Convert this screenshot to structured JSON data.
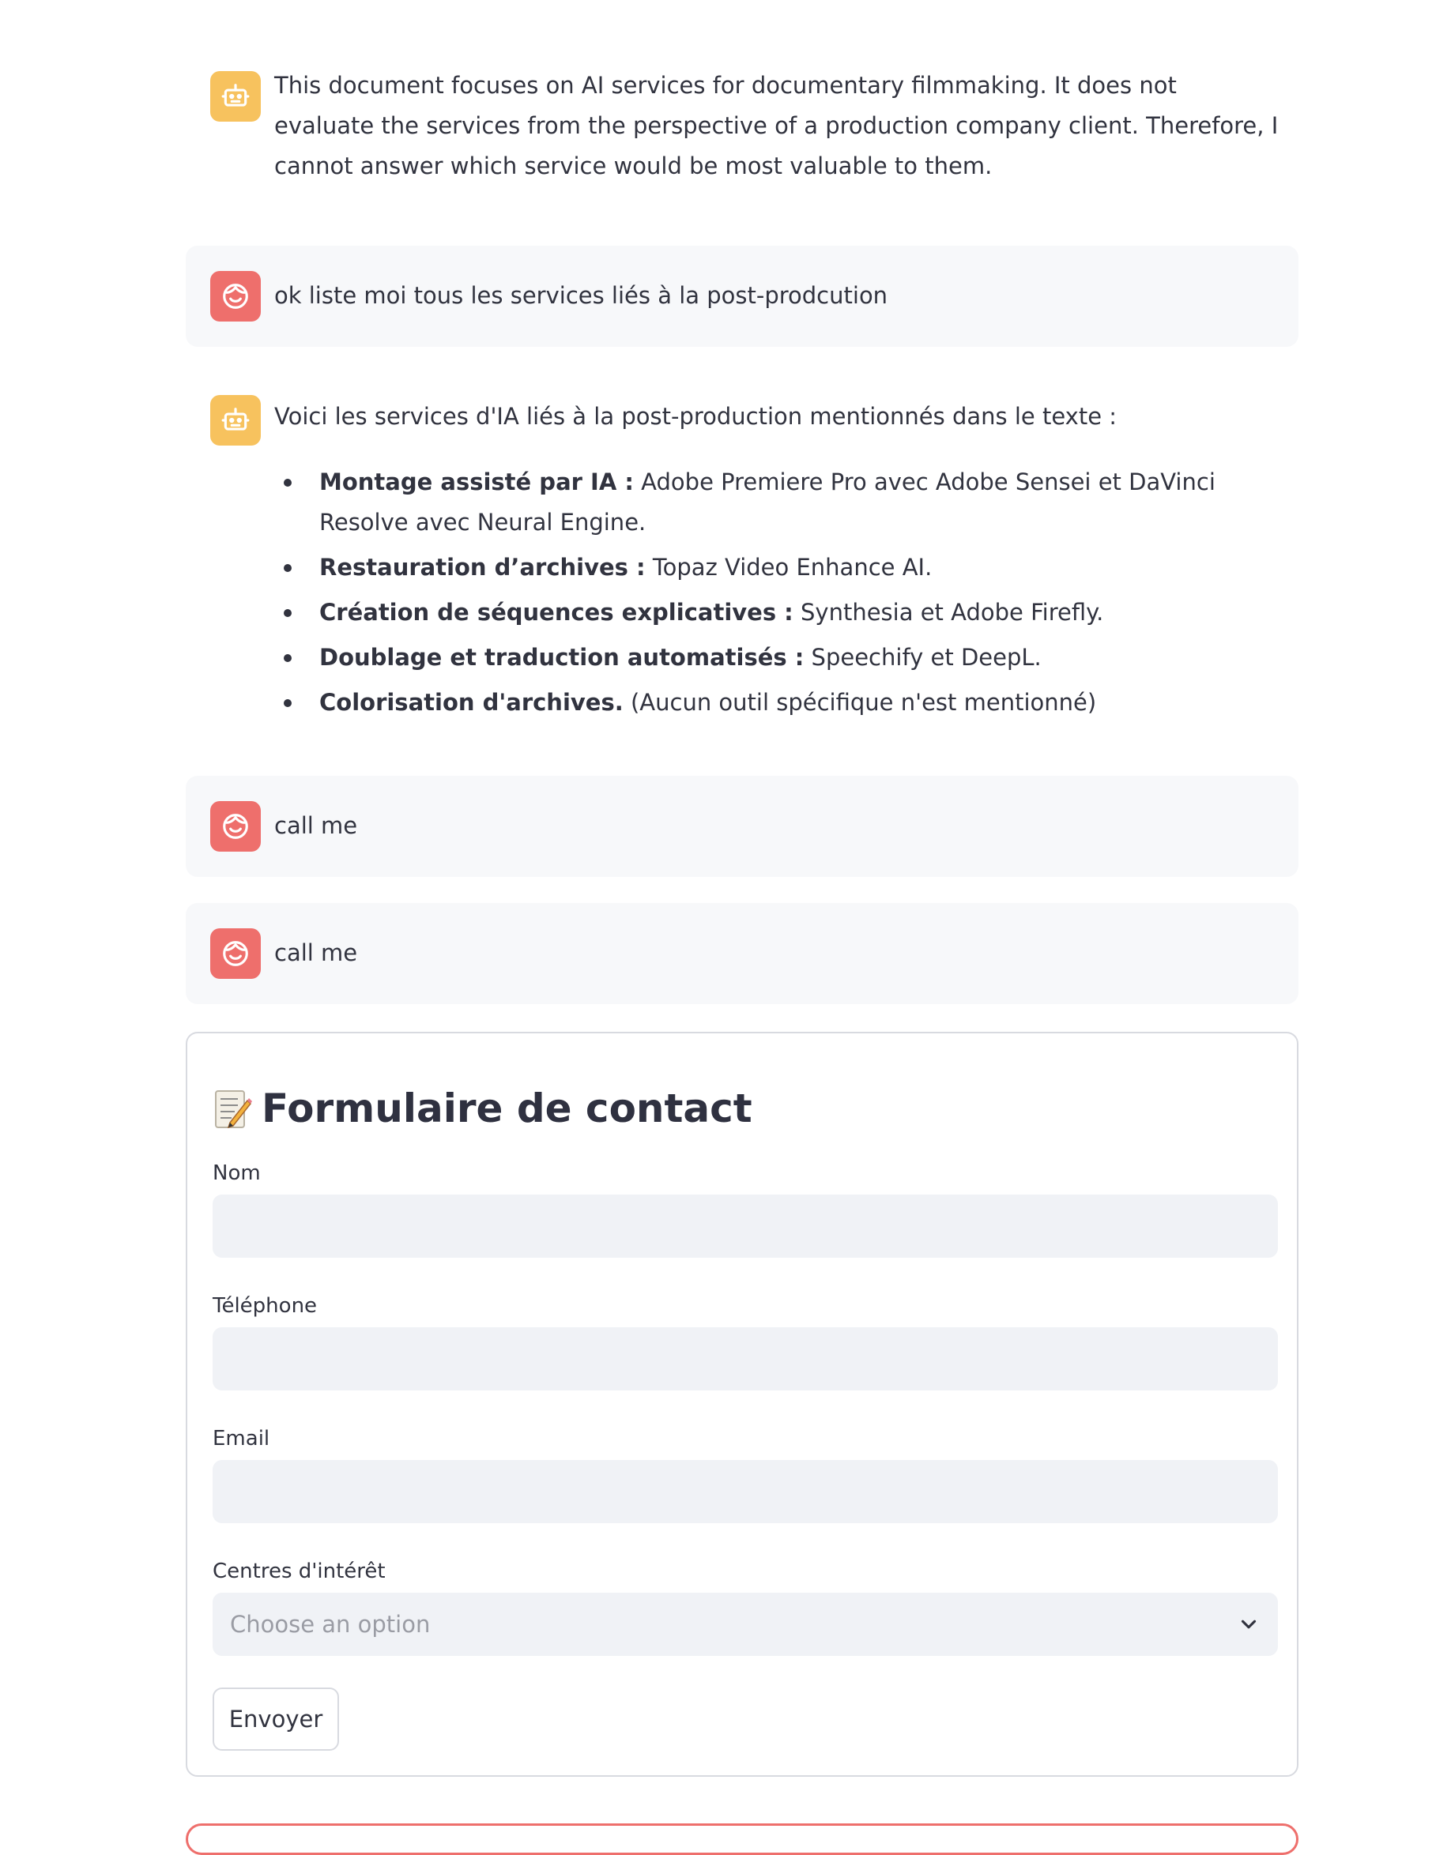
{
  "messages": [
    {
      "role": "assistant",
      "text": "This document focuses on AI services for documentary filmmaking. It does not evaluate the services from the perspective of a production company client. Therefore, I cannot answer which service would be most valuable to them."
    },
    {
      "role": "user",
      "text": "ok liste moi tous les services liés à la post-prodcution"
    },
    {
      "role": "assistant",
      "intro": "Voici les services d'IA liés à la post-production mentionnés dans le texte :",
      "items": [
        {
          "bold": "Montage assisté par IA :",
          "rest": " Adobe Premiere Pro avec Adobe Sensei et DaVinci Resolve avec Neural Engine."
        },
        {
          "bold": "Restauration d’archives :",
          "rest": " Topaz Video Enhance AI."
        },
        {
          "bold": "Création de séquences explicatives :",
          "rest": " Synthesia et Adobe Firefly."
        },
        {
          "bold": "Doublage et traduction automatisés :",
          "rest": " Speechify et DeepL."
        },
        {
          "bold": "Colorisation d'archives.",
          "rest": " (Aucun outil spécifique n'est mentionné)"
        }
      ]
    },
    {
      "role": "user",
      "text": "call me"
    },
    {
      "role": "user",
      "text": "call me"
    }
  ],
  "form": {
    "title": "Formulaire de contact",
    "title_icon": "memo-icon",
    "fields": {
      "name_label": "Nom",
      "name_value": "",
      "phone_label": "Téléphone",
      "phone_value": "",
      "email_label": "Email",
      "email_value": "",
      "interests_label": "Centres d'intérêt",
      "interests_placeholder": "Choose an option"
    },
    "submit_label": "Envoyer"
  },
  "colors": {
    "assistant_avatar": "#f7c25e",
    "user_avatar": "#ee6f6c",
    "user_bubble": "#f7f8fa",
    "input_bg": "#f0f2f6",
    "text": "#31333f"
  }
}
